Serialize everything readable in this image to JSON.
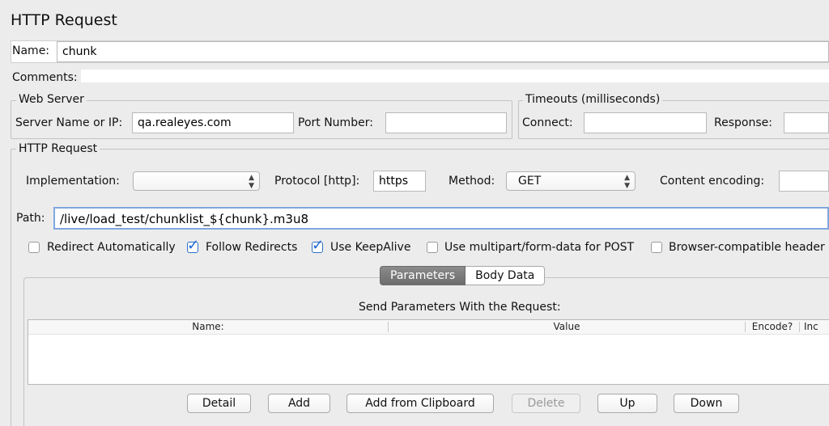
{
  "title": "HTTP Request",
  "name_row": {
    "label": "Name:",
    "value": "chunk"
  },
  "comments_row": {
    "label": "Comments:",
    "value": ""
  },
  "web_server": {
    "group_title": "Web Server",
    "server_label": "Server Name or IP:",
    "server_value": "qa.realeyes.com",
    "port_label": "Port Number:",
    "port_value": ""
  },
  "timeouts": {
    "group_title": "Timeouts (milliseconds)",
    "connect_label": "Connect:",
    "connect_value": "",
    "response_label": "Response:",
    "response_value": ""
  },
  "http_request": {
    "group_title": "HTTP Request",
    "implementation_label": "Implementation:",
    "implementation_value": "",
    "protocol_label": "Protocol [http]:",
    "protocol_value": "https",
    "method_label": "Method:",
    "method_value": "GET",
    "encoding_label": "Content encoding:",
    "encoding_value": "",
    "path_label": "Path:",
    "path_value": "/live/load_test/chunklist_${chunk}.m3u8"
  },
  "options": [
    {
      "label": "Redirect Automatically",
      "checked": false
    },
    {
      "label": "Follow Redirects",
      "checked": true
    },
    {
      "label": "Use KeepAlive",
      "checked": true
    },
    {
      "label": "Use multipart/form-data for POST",
      "checked": false
    },
    {
      "label": "Browser-compatible header",
      "checked": false
    }
  ],
  "tabs": [
    {
      "label": "Parameters",
      "active": true
    },
    {
      "label": "Body Data",
      "active": false
    }
  ],
  "params": {
    "caption": "Send Parameters With the Request:",
    "columns": [
      "Name:",
      "Value",
      "Encode?",
      "Inc"
    ]
  },
  "buttons": {
    "detail": "Detail",
    "add": "Add",
    "add_clipboard": "Add from Clipboard",
    "delete": "Delete",
    "up": "Up",
    "down": "Down"
  },
  "colors": {
    "accent": "#2066d4",
    "background": "#ececec"
  }
}
